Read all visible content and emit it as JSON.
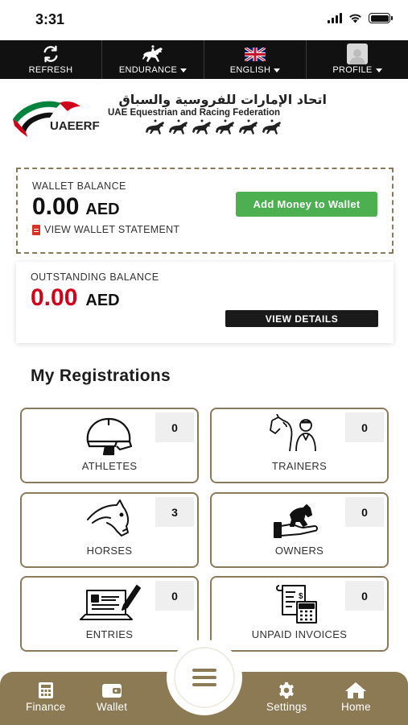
{
  "status": {
    "time": "3:31"
  },
  "topnav": {
    "refresh": "REFRESH",
    "discipline": "ENDURANCE",
    "language": "ENGLISH",
    "profile": "PROFILE"
  },
  "header": {
    "abbr": "UAEERF",
    "arabic_name": "اتحاد الإمارات للفروسية والسباق",
    "english_name": "UAE Equestrian and Racing Federation"
  },
  "wallet": {
    "title": "WALLET BALANCE",
    "amount": "0.00",
    "currency": "AED",
    "statement_link": "VIEW WALLET STATEMENT",
    "add_money_label": "Add Money to Wallet"
  },
  "outstanding": {
    "title": "OUTSTANDING BALANCE",
    "amount": "0.00",
    "currency": "AED",
    "details_label": "VIEW DETAILS"
  },
  "registrations": {
    "title": "My Registrations",
    "items": [
      {
        "label": "ATHLETES",
        "count": "0",
        "icon": "helmet-icon"
      },
      {
        "label": "TRAINERS",
        "count": "0",
        "icon": "trainer-horse-icon"
      },
      {
        "label": "HORSES",
        "count": "3",
        "icon": "horse-head-icon"
      },
      {
        "label": "OWNERS",
        "count": "0",
        "icon": "hand-horse-icon"
      },
      {
        "label": "ENTRIES",
        "count": "0",
        "icon": "laptop-entry-icon"
      },
      {
        "label": "UNPAID INVOICES",
        "count": "0",
        "icon": "invoice-calculator-icon"
      }
    ]
  },
  "bottomnav": {
    "finance": "Finance",
    "wallet": "Wallet",
    "settings": "Settings",
    "home": "Home"
  },
  "colors": {
    "nav_bg": "#111111",
    "accent_gold": "#8c7a55",
    "add_money_green": "#4caf50",
    "outstanding_red": "#d0021b"
  }
}
